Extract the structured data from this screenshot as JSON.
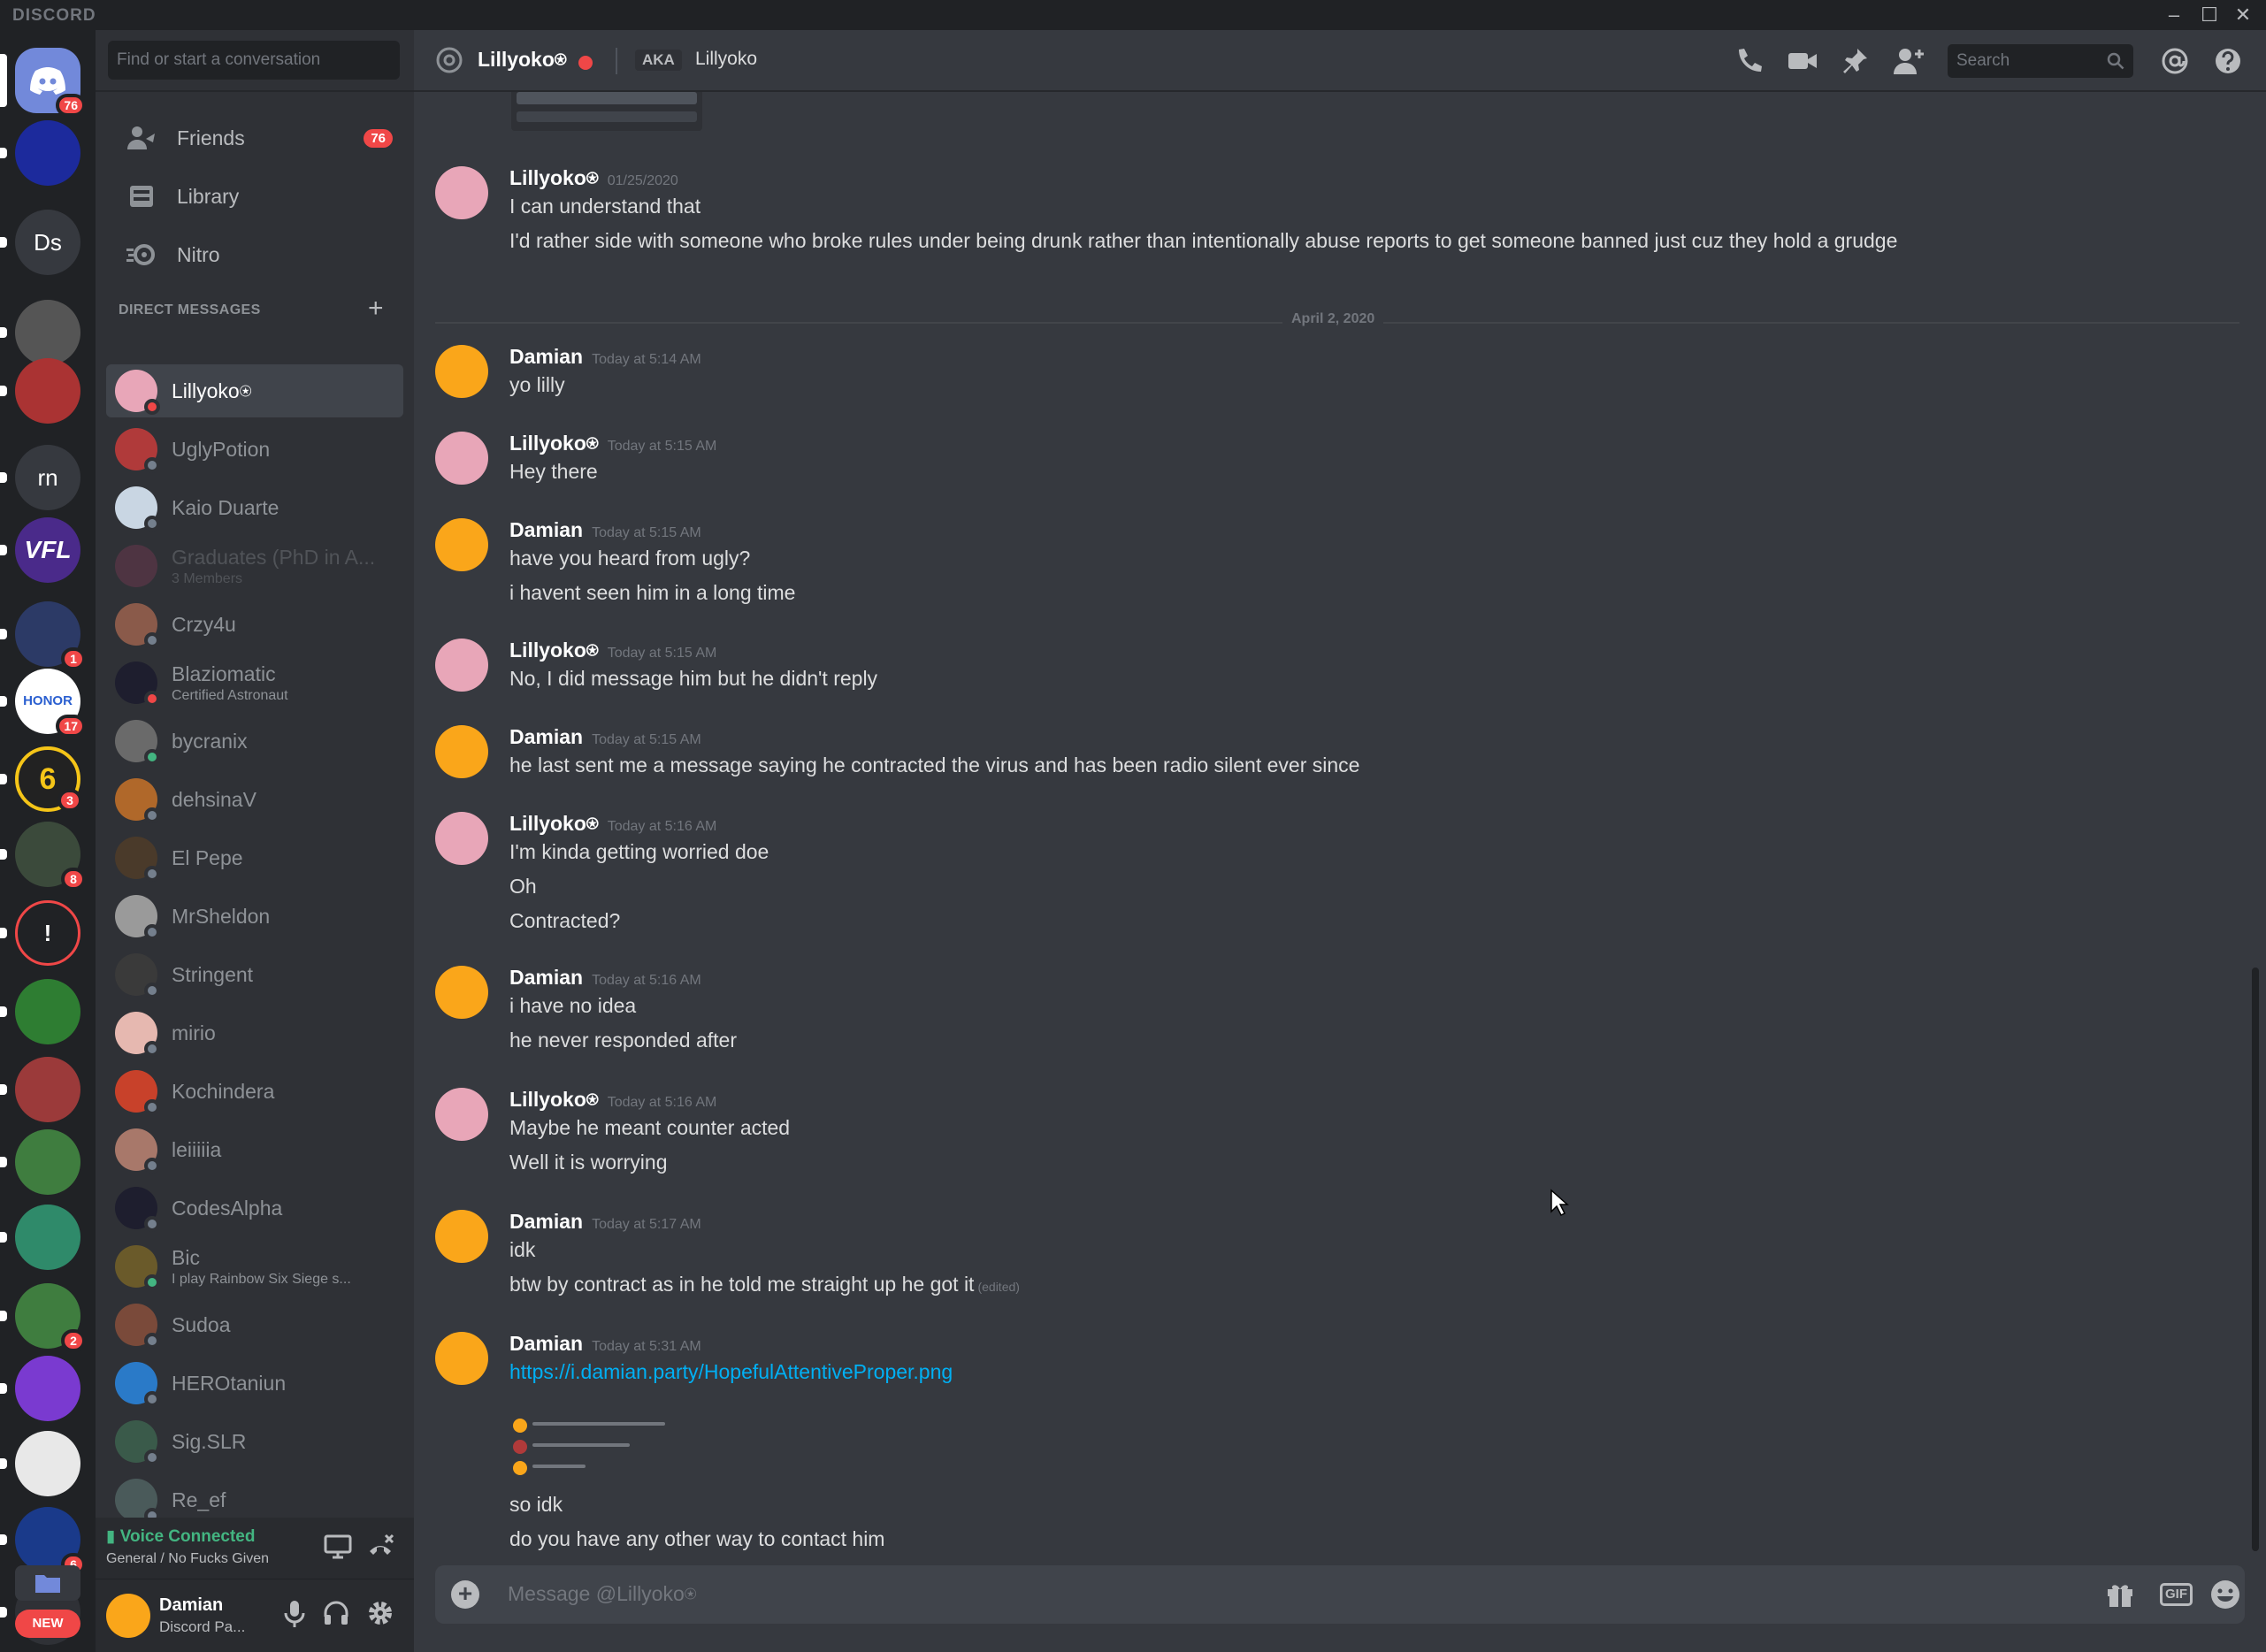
{
  "app": {
    "brand": "DISCORD"
  },
  "servers": [
    {
      "label": "",
      "badge": "76",
      "kind": "home"
    },
    {
      "label": "",
      "badge": "",
      "color": "#1c2a9c"
    },
    {
      "label": "Ds",
      "badge": "",
      "color": "#36393f"
    },
    {
      "label": "",
      "badge": "",
      "color": "#555"
    },
    {
      "label": "",
      "badge": "",
      "color": "#a33"
    },
    {
      "label": "rn",
      "badge": "",
      "color": "#36393f"
    },
    {
      "label": "VFL",
      "badge": "",
      "color": "#4a2a8a"
    },
    {
      "label": "",
      "badge": "1",
      "color": "#2c3a66"
    },
    {
      "label": "HONOR",
      "badge": "17",
      "color": "#ffffff"
    },
    {
      "label": "6",
      "badge": "3",
      "color": "#222"
    },
    {
      "label": "",
      "badge": "8",
      "color": "#3b4a3b"
    },
    {
      "label": "!",
      "badge": "",
      "color": "#202225"
    },
    {
      "label": "",
      "badge": "",
      "color": "#2e7d32"
    },
    {
      "label": "",
      "badge": "",
      "color": "#9b3a3a"
    },
    {
      "label": "",
      "badge": "",
      "color": "#3f7d3f"
    },
    {
      "label": "",
      "badge": "",
      "color": "#2f8a6a"
    },
    {
      "label": "",
      "badge": "2",
      "color": "#3f7d3f"
    },
    {
      "label": "",
      "badge": "",
      "color": "#7a3ad0"
    },
    {
      "label": "",
      "badge": "",
      "color": "#e8e8e8"
    },
    {
      "label": "",
      "badge": "6",
      "color": "#1a3a8a"
    },
    {
      "label": "",
      "badge": "",
      "color": "#2f3136"
    }
  ],
  "new_label": "NEW",
  "sidebar": {
    "search_placeholder": "Find or start a conversation",
    "nav": [
      {
        "label": "Friends",
        "count": "76",
        "icon": "friends-icon"
      },
      {
        "label": "Library",
        "count": "",
        "icon": "library-icon"
      },
      {
        "label": "Nitro",
        "count": "",
        "icon": "nitro-icon"
      }
    ],
    "dm_header": "DIRECT MESSAGES",
    "dms": [
      {
        "name": "Lillyoko⍟",
        "sub": "",
        "status": "dnd",
        "color": "#e8a6b8",
        "active": true
      },
      {
        "name": "UglyPotion",
        "sub": "",
        "status": "off",
        "color": "#b03a3a"
      },
      {
        "name": "Kaio Duarte",
        "sub": "",
        "status": "off",
        "color": "#c9d6e3"
      },
      {
        "name": "Graduates (PhD in A...",
        "sub": "3 Members",
        "status": "none",
        "color": "#8a3a5a",
        "faded": true
      },
      {
        "name": "Crzy4u",
        "sub": "",
        "status": "off",
        "color": "#8a5a4a"
      },
      {
        "name": "Blaziomatic",
        "sub": "Certified Astronaut",
        "status": "dnd",
        "color": "#1e1e2e"
      },
      {
        "name": "bycranix",
        "sub": "",
        "status": "on",
        "color": "#6a6a6a"
      },
      {
        "name": "dehsinaV",
        "sub": "",
        "status": "off",
        "color": "#b0682a"
      },
      {
        "name": "El Pepe",
        "sub": "",
        "status": "off",
        "color": "#4a3a2a"
      },
      {
        "name": "MrSheldon",
        "sub": "",
        "status": "off",
        "color": "#9a9a9a"
      },
      {
        "name": "Stringent",
        "sub": "",
        "status": "off",
        "color": "#3a3a3a"
      },
      {
        "name": "mirio",
        "sub": "",
        "status": "off",
        "color": "#e6b8b0"
      },
      {
        "name": "Kochindera",
        "sub": "",
        "status": "off",
        "color": "#c8412a"
      },
      {
        "name": "leiiiiia",
        "sub": "",
        "status": "off",
        "color": "#a8786a"
      },
      {
        "name": "CodesAlpha",
        "sub": "",
        "status": "off",
        "color": "#1e1e2e"
      },
      {
        "name": "Bic",
        "sub": "I play Rainbow Six Siege s...",
        "status": "on",
        "color": "#6a5a2a"
      },
      {
        "name": "Sudoa",
        "sub": "",
        "status": "off",
        "color": "#7a4a3a"
      },
      {
        "name": "HEROtaniun",
        "sub": "",
        "status": "off",
        "color": "#2a7ac8"
      },
      {
        "name": "Sig.SLR",
        "sub": "",
        "status": "off",
        "color": "#3a5a4a"
      },
      {
        "name": "Re_ef",
        "sub": "",
        "status": "off",
        "color": "#4a5a5a"
      }
    ],
    "voice": {
      "status": "Voice Connected",
      "channel": "General / No Fucks Given"
    },
    "user": {
      "name": "Damian",
      "status": "Discord Pa..."
    }
  },
  "header": {
    "title": "Lillyoko⍟",
    "aka": "AKA",
    "aka_name": "Lillyoko",
    "search_placeholder": "Search"
  },
  "messages": [
    {
      "author": "Lillyoko⍟",
      "time": "01/25/2020",
      "av": "lilly",
      "lines": [
        "I can understand that",
        "I'd rather side with someone who broke rules under being drunk rather than intentionally abuse reports to get someone banned just cuz they hold a grudge"
      ]
    },
    {
      "author": "Damian",
      "time": "Today at 5:14 AM",
      "av": "damian",
      "lines": [
        "yo lilly"
      ]
    },
    {
      "author": "Lillyoko⍟",
      "time": "Today at 5:15 AM",
      "av": "lilly",
      "lines": [
        "Hey there"
      ]
    },
    {
      "author": "Damian",
      "time": "Today at 5:15 AM",
      "av": "damian",
      "lines": [
        "have you heard from ugly?",
        "i havent seen him in a long time"
      ]
    },
    {
      "author": "Lillyoko⍟",
      "time": "Today at 5:15 AM",
      "av": "lilly",
      "lines": [
        "No, I did message him but he didn't reply"
      ]
    },
    {
      "author": "Damian",
      "time": "Today at 5:15 AM",
      "av": "damian",
      "lines": [
        "he last sent me a message saying he contracted the virus and has been radio silent ever since"
      ]
    },
    {
      "author": "Lillyoko⍟",
      "time": "Today at 5:16 AM",
      "av": "lilly",
      "lines": [
        "I'm kinda getting worried doe",
        "Oh",
        "Contracted?"
      ]
    },
    {
      "author": "Damian",
      "time": "Today at 5:16 AM",
      "av": "damian",
      "lines": [
        "i have no idea",
        "he never responded after"
      ]
    },
    {
      "author": "Lillyoko⍟",
      "time": "Today at 5:16 AM",
      "av": "lilly",
      "lines": [
        "Maybe he meant counter acted",
        "Well it is worrying"
      ]
    },
    {
      "author": "Damian",
      "time": "Today at 5:17 AM",
      "av": "damian",
      "lines": [
        "idk",
        "btw by contract as in he told me straight up he got it"
      ],
      "edited": "(edited)"
    },
    {
      "author": "Damian",
      "time": "Today at 5:31 AM",
      "av": "damian",
      "link": "https://i.damian.party/HopefulAttentiveProper.png",
      "lines": [
        "so idk",
        "do you have any other way to contact him"
      ]
    }
  ],
  "day_divider": "April 2, 2020",
  "composer": {
    "placeholder": "Message @Lillyoko⍟",
    "gif": "GIF"
  },
  "colors": {
    "blurple": "#7289da",
    "dnd": "#f04747",
    "online": "#43b581",
    "link": "#00b0f4",
    "damian": "#faa61a",
    "lilly": "#e8a6b8"
  }
}
